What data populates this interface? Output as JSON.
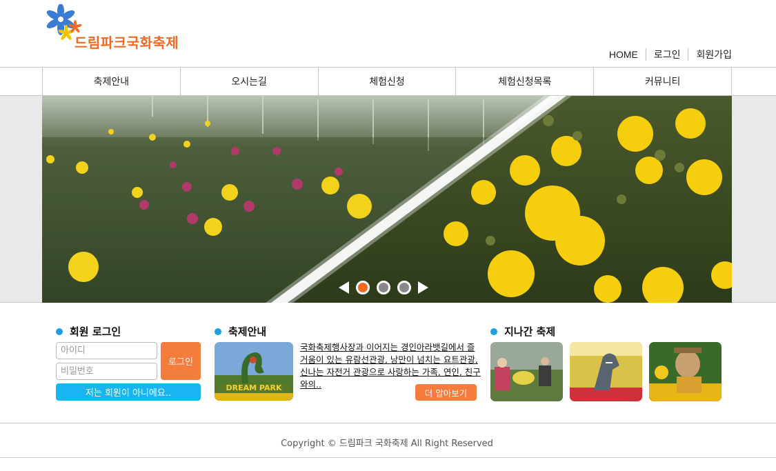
{
  "header": {
    "logo_text": "드림파크국화축제",
    "top_links": [
      "HOME",
      "로그인",
      "회원가입"
    ]
  },
  "nav": {
    "items": [
      "축제안내",
      "오시는길",
      "체험신청",
      "체험신청목록",
      "커뮤니티"
    ]
  },
  "slider": {
    "active_index": 0,
    "dots": 3,
    "colors": {
      "active": "#f26a21",
      "inactive": "#888888"
    }
  },
  "login": {
    "title": "회원 로그인",
    "id_placeholder": "아이디",
    "pw_placeholder": "비밀번호",
    "login_button": "로그인",
    "signup_button": "저는 회원이 아니에요.."
  },
  "festival_info": {
    "title": "축제안내",
    "text": "국화축제행사장과 이어지는 경인아라뱃길에서 즐거움이 있는 유람선관광, 낭만이 넘치는 요트관광, 신나는 자전거 관광으로 사랑하는 가족, 연인, 친구와의..",
    "more_button": "더 알아보기",
    "image_caption": "DREAM PARK"
  },
  "past_festival": {
    "title": "지나간 축제",
    "thumbnails": [
      "worker-thumb",
      "dinosaur-thumb",
      "statue-thumb"
    ]
  },
  "footer": {
    "copyright": "Copyright © 드림파크 국화축제 All Right Reserved"
  },
  "colors": {
    "brand_orange": "#f26a21",
    "button_orange": "#f47c3c",
    "accent_blue": "#19b5f0",
    "bullet_blue": "#1a9ce6"
  }
}
